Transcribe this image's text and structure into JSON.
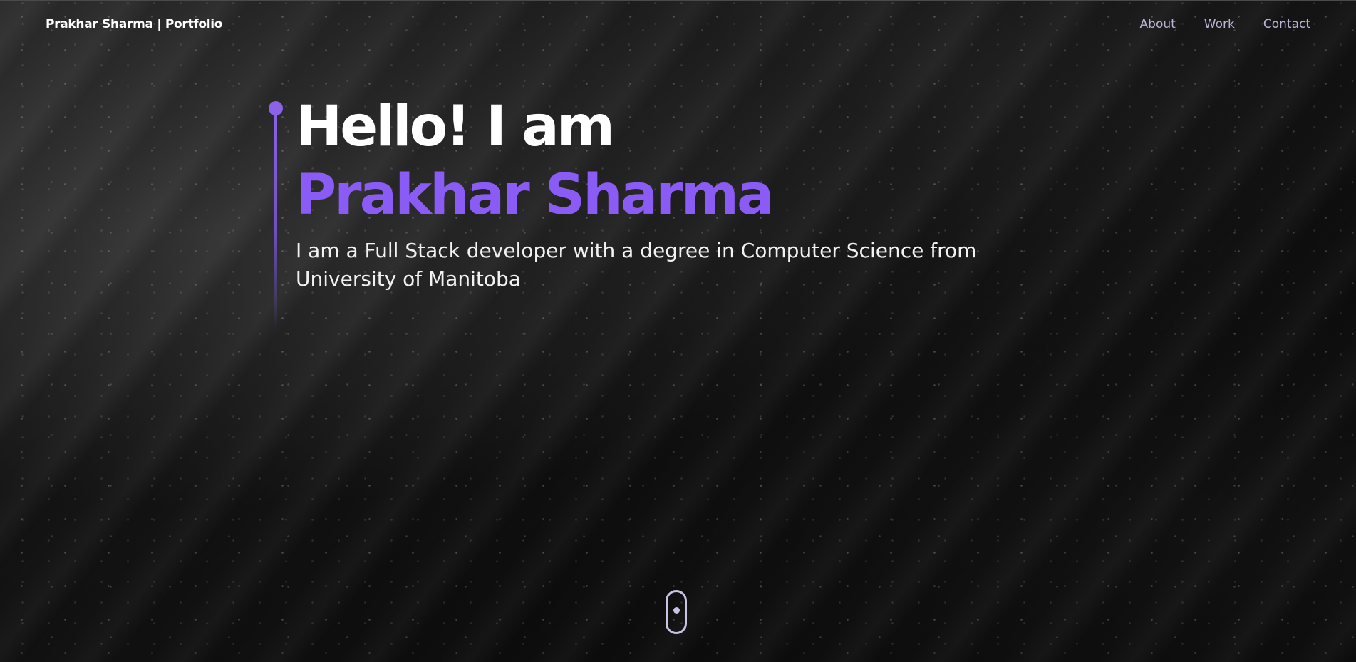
{
  "header": {
    "brand": "Prakhar Sharma | Portfolio",
    "nav": [
      {
        "label": "About"
      },
      {
        "label": "Work"
      },
      {
        "label": "Contact"
      }
    ]
  },
  "hero": {
    "greeting": "Hello! I am",
    "name": "Prakhar Sharma",
    "description": "I am a Full Stack developer with a degree in Computer Science from University of Manitoba"
  },
  "theme": {
    "accent": "#8a5cf5",
    "nav_text": "#b9b3d6",
    "background": "#0b0b0b"
  },
  "icons": {
    "scroll": "mouse-scroll-icon"
  }
}
